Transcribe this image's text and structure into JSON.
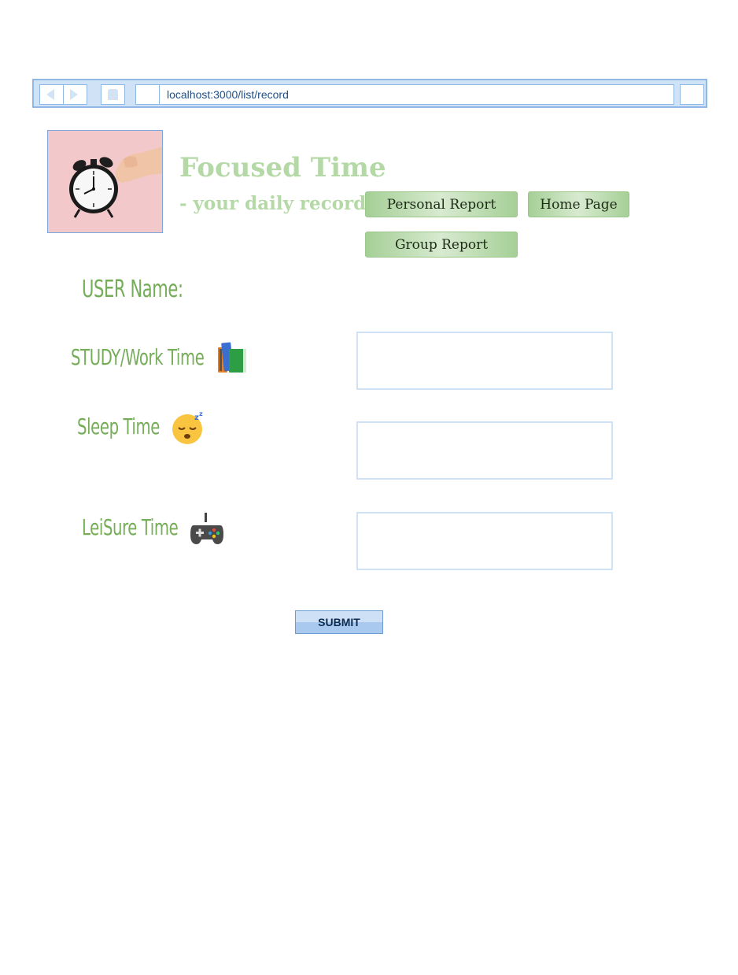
{
  "browser": {
    "url": "localhost:3000/list/record"
  },
  "header": {
    "title": "Focused Time",
    "subtitle": "- your daily record",
    "nav": {
      "personal_report": "Personal Report",
      "home_page": "Home Page",
      "group_report": "Group Report"
    }
  },
  "form": {
    "username_label": "USER Name:",
    "study_label": "STUDY/Work Time",
    "sleep_label": "Sleep Time",
    "leisure_label": "LeiSure Time",
    "submit_label": "SUBMIT"
  },
  "icons": {
    "logo": "alarm-clock-icon",
    "study": "books-icon",
    "sleep": "sleeping-face-icon",
    "leisure": "game-controller-icon"
  },
  "colors": {
    "accent_green": "#75ad58",
    "title_green": "#b4d9a6",
    "chrome_blue": "#cfe2f6"
  }
}
